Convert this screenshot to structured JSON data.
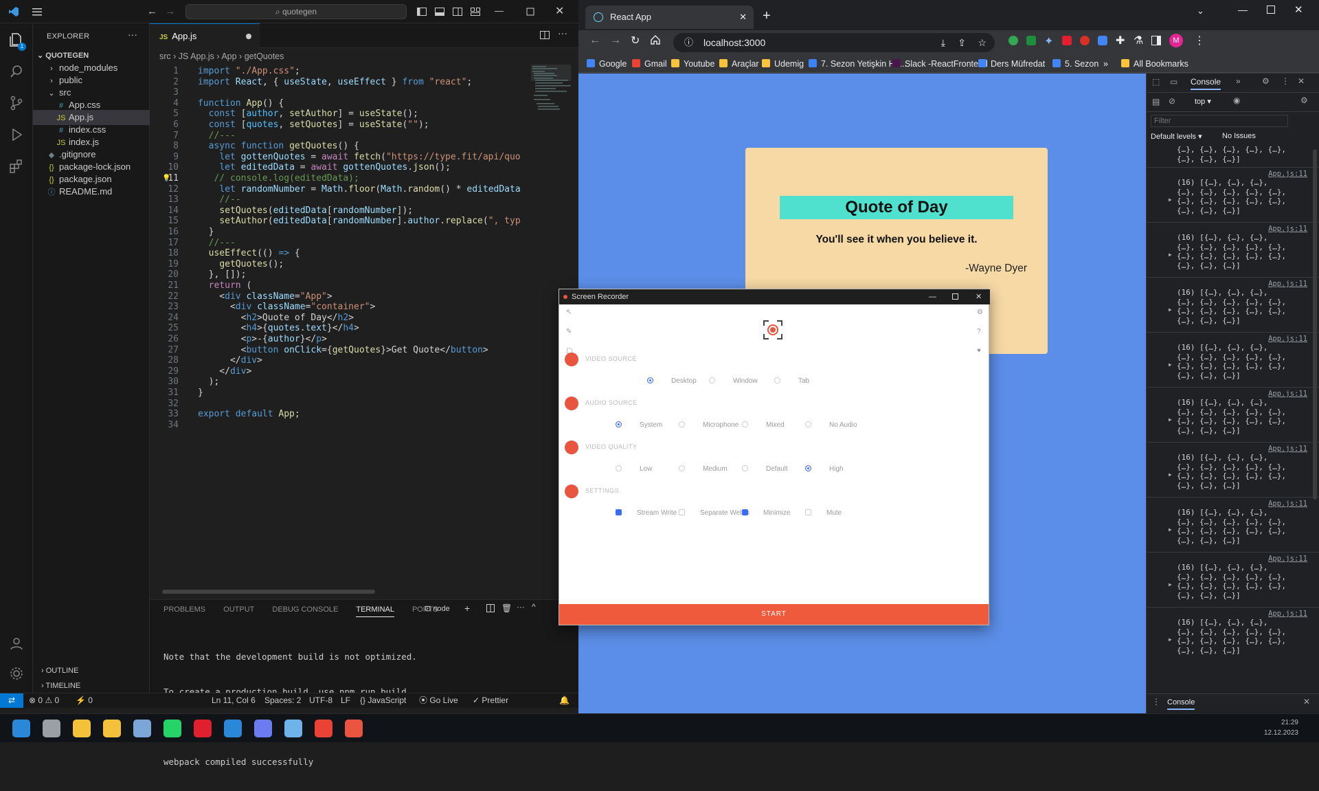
{
  "vscode": {
    "command_center": "quotegen",
    "explorer_title": "EXPLORER",
    "explorer_more": "···",
    "project": "QUOTEGEN",
    "tree": [
      {
        "label": "node_modules",
        "icon": "›",
        "color": "#ccc"
      },
      {
        "label": "public",
        "icon": "›",
        "color": "#ccc"
      },
      {
        "label": "src",
        "icon": "⌄",
        "color": "#ccc"
      },
      {
        "label": "App.css",
        "icon": "#",
        "color": "#519aba"
      },
      {
        "label": "App.js",
        "icon": "JS",
        "color": "#cbcb41"
      },
      {
        "label": "index.css",
        "icon": "#",
        "color": "#519aba"
      },
      {
        "label": "index.js",
        "icon": "JS",
        "color": "#cbcb41"
      },
      {
        "label": ".gitignore",
        "icon": "◆",
        "color": "#6d8086"
      },
      {
        "label": "package-lock.json",
        "icon": "{}",
        "color": "#cbcb41"
      },
      {
        "label": "package.json",
        "icon": "{}",
        "color": "#cbcb41"
      },
      {
        "label": "README.md",
        "icon": "ⓘ",
        "color": "#519aba"
      }
    ],
    "tab_label": "App.js",
    "tab_icon_text": "JS",
    "breadcrumb": [
      "src",
      "JS App.js",
      "App",
      "getQuotes"
    ],
    "code": [
      [
        [
          "kw",
          "import "
        ],
        [
          "st",
          "\"./App.css\""
        ],
        [
          "pl",
          ";"
        ]
      ],
      [
        [
          "kw",
          "import "
        ],
        [
          "vr",
          "React"
        ],
        [
          "pl",
          ", { "
        ],
        [
          "vr",
          "useState"
        ],
        [
          "pl",
          ", "
        ],
        [
          "vr",
          "useEffect"
        ],
        [
          "pl",
          " } "
        ],
        [
          "kw",
          "from "
        ],
        [
          "st",
          "\"react\""
        ],
        [
          "pl",
          ";"
        ]
      ],
      [],
      [
        [
          "kw",
          "function "
        ],
        [
          "fn",
          "App"
        ],
        [
          "pl",
          "() {"
        ]
      ],
      [
        [
          "pl",
          "  "
        ],
        [
          "kw",
          "const "
        ],
        [
          "pl",
          "["
        ],
        [
          "cs",
          "author"
        ],
        [
          "pl",
          ", "
        ],
        [
          "fn",
          "setAuthor"
        ],
        [
          "pl",
          "] = "
        ],
        [
          "fn",
          "useState"
        ],
        [
          "pl",
          "();"
        ]
      ],
      [
        [
          "pl",
          "  "
        ],
        [
          "kw",
          "const "
        ],
        [
          "pl",
          "["
        ],
        [
          "cs",
          "quotes"
        ],
        [
          "pl",
          ", "
        ],
        [
          "fn",
          "setQuotes"
        ],
        [
          "pl",
          "] = "
        ],
        [
          "fn",
          "useState"
        ],
        [
          "pl",
          "("
        ],
        [
          "st",
          "\"\""
        ],
        [
          "pl",
          ");"
        ]
      ],
      [
        [
          "cm",
          "  //---"
        ]
      ],
      [
        [
          "pl",
          "  "
        ],
        [
          "kw",
          "async function "
        ],
        [
          "fn",
          "getQuotes"
        ],
        [
          "pl",
          "() {"
        ]
      ],
      [
        [
          "pl",
          "    "
        ],
        [
          "kw",
          "let "
        ],
        [
          "vr",
          "gottenQuotes"
        ],
        [
          "pl",
          " = "
        ],
        [
          "kp",
          "await "
        ],
        [
          "fn",
          "fetch"
        ],
        [
          "pl",
          "("
        ],
        [
          "st",
          "\"https://type.fit/api/quot"
        ]
      ],
      [
        [
          "pl",
          "    "
        ],
        [
          "kw",
          "let "
        ],
        [
          "vr",
          "editedData"
        ],
        [
          "pl",
          " = "
        ],
        [
          "kp",
          "await "
        ],
        [
          "vr",
          "gottenQuotes"
        ],
        [
          "pl",
          "."
        ],
        [
          "fn",
          "json"
        ],
        [
          "pl",
          "();"
        ]
      ],
      [
        [
          "cm",
          "   // console.log(editedData);"
        ]
      ],
      [
        [
          "pl",
          "    "
        ],
        [
          "kw",
          "let "
        ],
        [
          "vr",
          "randomNumber"
        ],
        [
          "pl",
          " = "
        ],
        [
          "vr",
          "Math"
        ],
        [
          "pl",
          "."
        ],
        [
          "fn",
          "floor"
        ],
        [
          "pl",
          "("
        ],
        [
          "vr",
          "Math"
        ],
        [
          "pl",
          "."
        ],
        [
          "fn",
          "random"
        ],
        [
          "pl",
          "() * "
        ],
        [
          "vr",
          "editedData"
        ],
        [
          "pl",
          "."
        ]
      ],
      [
        [
          "cm",
          "    //--"
        ]
      ],
      [
        [
          "pl",
          "    "
        ],
        [
          "fn",
          "setQuotes"
        ],
        [
          "pl",
          "("
        ],
        [
          "vr",
          "editedData"
        ],
        [
          "pl",
          "["
        ],
        [
          "vr",
          "randomNumber"
        ],
        [
          "pl",
          "]);"
        ]
      ],
      [
        [
          "pl",
          "    "
        ],
        [
          "fn",
          "setAuthor"
        ],
        [
          "pl",
          "("
        ],
        [
          "vr",
          "editedData"
        ],
        [
          "pl",
          "["
        ],
        [
          "vr",
          "randomNumber"
        ],
        [
          "pl",
          "]."
        ],
        [
          "vr",
          "author"
        ],
        [
          "pl",
          "."
        ],
        [
          "fn",
          "replace"
        ],
        [
          "pl",
          "("
        ],
        [
          "st",
          "\", type"
        ]
      ],
      [
        [
          "pl",
          "  }"
        ]
      ],
      [
        [
          "cm",
          "  //---"
        ]
      ],
      [
        [
          "pl",
          "  "
        ],
        [
          "fn",
          "useEffect"
        ],
        [
          "pl",
          "(() "
        ],
        [
          "kw",
          "=>"
        ],
        [
          "pl",
          " {"
        ]
      ],
      [
        [
          "pl",
          "    "
        ],
        [
          "fn",
          "getQuotes"
        ],
        [
          "pl",
          "();"
        ]
      ],
      [
        [
          "pl",
          "  }, []);"
        ]
      ],
      [
        [
          "pl",
          "  "
        ],
        [
          "kp",
          "return "
        ],
        [
          "pl",
          "("
        ]
      ],
      [
        [
          "pl",
          "    <"
        ],
        [
          "tg",
          "div "
        ],
        [
          "at",
          "className"
        ],
        [
          "pl",
          "="
        ],
        [
          "st",
          "\"App\""
        ],
        [
          "pl",
          ">"
        ]
      ],
      [
        [
          "pl",
          "      <"
        ],
        [
          "tg",
          "div "
        ],
        [
          "at",
          "className"
        ],
        [
          "pl",
          "="
        ],
        [
          "st",
          "\"container\""
        ],
        [
          "pl",
          ">"
        ]
      ],
      [
        [
          "pl",
          "        <"
        ],
        [
          "tg",
          "h2"
        ],
        [
          "pl",
          ">Quote of Day</"
        ],
        [
          "tg",
          "h2"
        ],
        [
          "pl",
          ">"
        ]
      ],
      [
        [
          "pl",
          "        <"
        ],
        [
          "tg",
          "h4"
        ],
        [
          "pl",
          ">{"
        ],
        [
          "vr",
          "quotes"
        ],
        [
          "pl",
          "."
        ],
        [
          "vr",
          "text"
        ],
        [
          "pl",
          "}</"
        ],
        [
          "tg",
          "h4"
        ],
        [
          "pl",
          ">"
        ]
      ],
      [
        [
          "pl",
          "        <"
        ],
        [
          "tg",
          "p"
        ],
        [
          "pl",
          ">-{"
        ],
        [
          "vr",
          "author"
        ],
        [
          "pl",
          "}</"
        ],
        [
          "tg",
          "p"
        ],
        [
          "pl",
          ">"
        ]
      ],
      [
        [
          "pl",
          "        <"
        ],
        [
          "tg",
          "button "
        ],
        [
          "at",
          "onClick"
        ],
        [
          "pl",
          "={"
        ],
        [
          "fn",
          "getQuotes"
        ],
        [
          "pl",
          "}>Get Quote</"
        ],
        [
          "tg",
          "button"
        ],
        [
          "pl",
          ">"
        ]
      ],
      [
        [
          "pl",
          "      </"
        ],
        [
          "tg",
          "div"
        ],
        [
          "pl",
          ">"
        ]
      ],
      [
        [
          "pl",
          "    </"
        ],
        [
          "tg",
          "div"
        ],
        [
          "pl",
          ">"
        ]
      ],
      [
        [
          "pl",
          "  );"
        ]
      ],
      [
        [
          "pl",
          "}"
        ]
      ],
      [],
      [
        [
          "kw",
          "export default "
        ],
        [
          "fn",
          "App"
        ],
        [
          "pl",
          ";"
        ]
      ],
      []
    ],
    "panel_tabs": [
      "PROBLEMS",
      "OUTPUT",
      "DEBUG CONSOLE",
      "TERMINAL",
      "PORTS"
    ],
    "active_panel_tab": "TERMINAL",
    "terminal_name": "node",
    "terminal_lines": [
      "Note that the development build is not optimized.",
      "To create a production build, use npm run build.",
      "",
      "webpack compiled successfully"
    ],
    "outline_label": "OUTLINE",
    "timeline_label": "TIMELINE",
    "status": {
      "errors": "⊗ 0 ⚠ 0",
      "ports": "⚡ 0",
      "position": "Ln 11, Col 6",
      "spaces": "Spaces: 2",
      "encoding": "UTF-8",
      "eol": "LF",
      "language": "{} JavaScript",
      "golive": "⦿ Go Live",
      "prettier": "✓ Prettier"
    }
  },
  "chrome": {
    "tab_title": "React App",
    "url": "localhost:3000",
    "bookmarks": [
      {
        "label": "Google",
        "color": "#4285f4"
      },
      {
        "label": "Gmail",
        "color": "#ea4335"
      },
      {
        "label": "Youtube",
        "color": "#f9c33c"
      },
      {
        "label": "Araçlar",
        "color": "#f9c33c"
      },
      {
        "label": "Udemig",
        "color": "#f9c33c"
      },
      {
        "label": "7. Sezon Yetişkin Ha...",
        "color": "#3b82f6"
      },
      {
        "label": "Slack -ReactFrontend",
        "color": "#4a154b"
      },
      {
        "label": "Ders Müfredat",
        "color": "#4285f4"
      },
      {
        "label": "5. Sezon",
        "color": "#4285f4"
      },
      {
        "label": "»",
        "color": ""
      },
      {
        "label": "All Bookmarks",
        "color": "#f9c33c"
      }
    ],
    "page": {
      "title": "Quote of Day",
      "quote": "You'll see it when you believe it.",
      "author": "-Wayne Dyer"
    },
    "devtools": {
      "tab": "Console",
      "context": "top",
      "filter_placeholder": "Filter",
      "levels": "Default levels ▾",
      "issues": "No Issues",
      "log_source": "App.js:11",
      "log_first_line": "(16) [{…}, {…}, {…},",
      "log_more_lines": "{…}, {…}, {…}, {…}, {…},\n{…}, {…}, {…}, {…}, {…},\n{…}, {…}, {…}]",
      "top_fragment": "{…}, {…}, {…}, {…}, {…},\n{…}, {…}, {…}]",
      "drawer_tab": "Console"
    }
  },
  "recorder": {
    "title": "Screen Recorder",
    "sections": [
      {
        "label": "VIDEO SOURCE",
        "type": "radio",
        "options": [
          {
            "label": "Desktop",
            "on": true
          },
          {
            "label": "Window",
            "on": false
          },
          {
            "label": "Tab",
            "on": false
          }
        ]
      },
      {
        "label": "AUDIO SOURCE",
        "type": "radio",
        "options": [
          {
            "label": "System",
            "on": true
          },
          {
            "label": "Microphone",
            "on": false
          },
          {
            "label": "Mixed",
            "on": false
          },
          {
            "label": "No Audio",
            "on": false
          }
        ]
      },
      {
        "label": "VIDEO QUALITY",
        "type": "radio",
        "options": [
          {
            "label": "Low",
            "on": false
          },
          {
            "label": "Medium",
            "on": false
          },
          {
            "label": "Default",
            "on": false
          },
          {
            "label": "High",
            "on": true
          }
        ]
      },
      {
        "label": "SETTINGS",
        "type": "check",
        "options": [
          {
            "label": "Stream Write",
            "on": true
          },
          {
            "label": "Separate Webm",
            "on": false
          },
          {
            "label": "Minimize",
            "on": true
          },
          {
            "label": "Mute",
            "on": false
          }
        ]
      }
    ],
    "start_label": "START"
  },
  "taskbar": {
    "icons": [
      {
        "name": "windows-start-icon",
        "color": "#2b88d8"
      },
      {
        "name": "file-manager-icon",
        "color": "#9aa0a6"
      },
      {
        "name": "folder-icon",
        "color": "#f3c13a"
      },
      {
        "name": "sticky-notes-icon",
        "color": "#f3c13a"
      },
      {
        "name": "notepad-icon",
        "color": "#7aa7d8"
      },
      {
        "name": "whatsapp-icon",
        "color": "#25d366"
      },
      {
        "name": "opera-icon",
        "color": "#e0202e"
      },
      {
        "name": "vscode-taskbar-icon",
        "color": "#2b88d8"
      },
      {
        "name": "discord-like-icon",
        "color": "#6b7bf0"
      },
      {
        "name": "steam-icon",
        "color": "#6fb4e8"
      },
      {
        "name": "chrome-taskbar-icon",
        "color": "#ea4335"
      },
      {
        "name": "recorder-taskbar-icon",
        "color": "#e9553e"
      }
    ],
    "time": "21:29",
    "date": "12.12.2023"
  },
  "colors": {
    "accent": "#0078d4",
    "page_bg": "#5b8ee8",
    "card_bg": "#f7d9a6",
    "title_bg": "#4fe1cd",
    "record": "#ef5a3c"
  }
}
